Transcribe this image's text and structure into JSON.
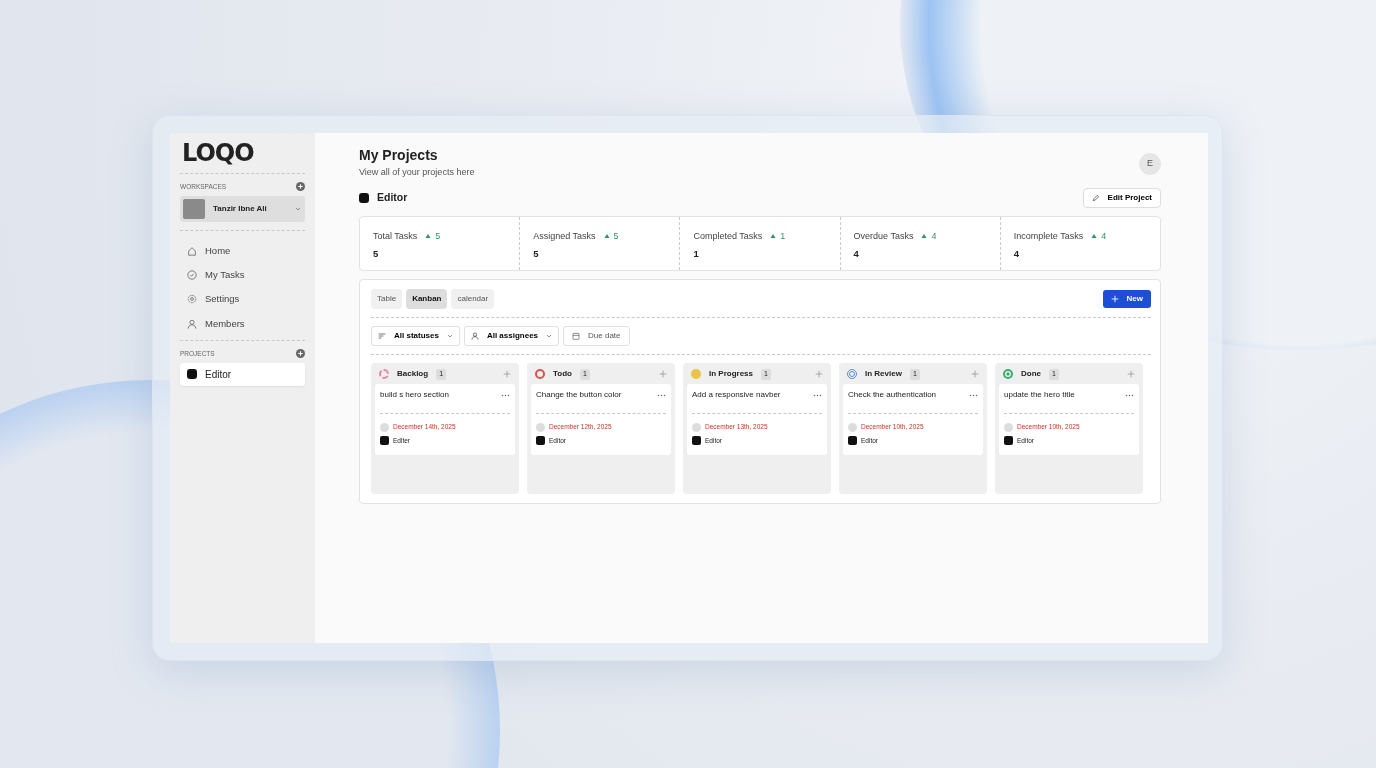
{
  "sidebar": {
    "logo": "LOQO",
    "workspaces_label": "WORKSPACES",
    "workspace": {
      "name": "Tanzir Ibne Ali"
    },
    "nav": [
      {
        "label": "Home",
        "kind": "home"
      },
      {
        "label": "My Tasks",
        "kind": "tasks"
      },
      {
        "label": "Settings",
        "kind": "settings"
      },
      {
        "label": "Members",
        "kind": "members"
      }
    ],
    "projects_label": "PROJECTS",
    "projects": [
      {
        "name": "Editor",
        "selected": true
      }
    ]
  },
  "header": {
    "title": "My Projects",
    "subtitle": "View all of your projects here",
    "avatar": "E"
  },
  "project": {
    "name": "Editor",
    "edit_button": "Edit Project"
  },
  "stats": [
    {
      "label": "Total Tasks",
      "delta": "5",
      "value": "5"
    },
    {
      "label": "Assigned Tasks",
      "delta": "5",
      "value": "5"
    },
    {
      "label": "Completed Tasks",
      "delta": "1",
      "value": "1"
    },
    {
      "label": "Overdue Tasks",
      "delta": "4",
      "value": "4"
    },
    {
      "label": "Incomplete Tasks",
      "delta": "4",
      "value": "4"
    }
  ],
  "views": [
    {
      "label": "Table",
      "selected": false
    },
    {
      "label": "Kanban",
      "selected": true
    },
    {
      "label": "calendar",
      "selected": false
    }
  ],
  "new_button": "New",
  "filters": [
    {
      "label": "All statuses",
      "kind": "status"
    },
    {
      "label": "All assignees",
      "kind": "assignee"
    },
    {
      "label": "Due date",
      "kind": "date"
    }
  ],
  "columns": [
    {
      "name": "Backlog",
      "count": "1",
      "kind": "backlog",
      "color": "#e48aa0",
      "cards": [
        {
          "title": "build s hero section",
          "due": "December 14th, 2025",
          "project": "Edlter"
        }
      ]
    },
    {
      "name": "Todo",
      "count": "1",
      "kind": "todo",
      "color": "#d9534f",
      "cards": [
        {
          "title": "Change the button color",
          "due": "December 12th, 2025",
          "project": "Editor"
        }
      ]
    },
    {
      "name": "In Progress",
      "count": "1",
      "kind": "progress",
      "color": "#e8c547",
      "cards": [
        {
          "title": "Add a responsive navber",
          "due": "December 13th, 2025",
          "project": "Editor"
        }
      ]
    },
    {
      "name": "In Review",
      "count": "1",
      "kind": "review",
      "color": "#5b8fd6",
      "cards": [
        {
          "title": "Check the authentication",
          "due": "December 10th, 2025",
          "project": "Editor"
        }
      ]
    },
    {
      "name": "Done",
      "count": "1",
      "kind": "done",
      "color": "#3aae6e",
      "cards": [
        {
          "title": "update the hero title",
          "due": "December 10th, 2025",
          "project": "Editor"
        }
      ]
    }
  ]
}
